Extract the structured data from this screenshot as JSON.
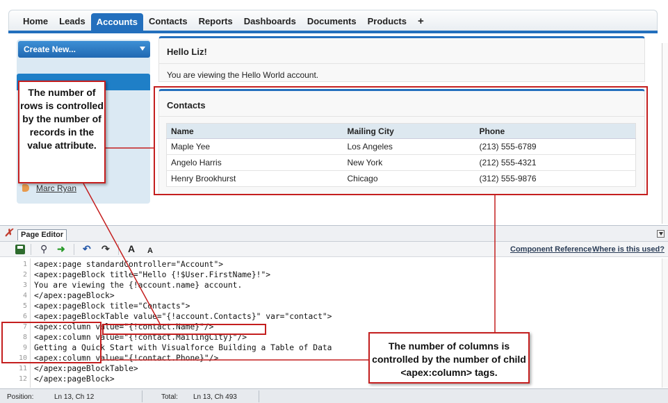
{
  "tabs": [
    "Home",
    "Leads",
    "Accounts",
    "Contacts",
    "Reports",
    "Dashboards",
    "Documents",
    "Products",
    "+"
  ],
  "active_tab": "Accounts",
  "sidebar": {
    "create_new_label": "Create New...",
    "recent_item": "Marc Ryan"
  },
  "hello_panel": {
    "title": "Hello Liz!",
    "body": "You are viewing the Hello World account."
  },
  "contacts_panel": {
    "title": "Contacts",
    "columns": [
      "Name",
      "Mailing City",
      "Phone"
    ],
    "rows": [
      [
        "Maple Yee",
        "Los Angeles",
        "(213) 555-6789"
      ],
      [
        "Angelo Harris",
        "New York",
        "(212) 555-4321"
      ],
      [
        "Henry Brookhurst",
        "Chicago",
        "(312) 555-9876"
      ]
    ]
  },
  "editor": {
    "tab_label": "Page Editor",
    "links": [
      "Component Reference",
      "Where is this used?"
    ],
    "code_lines": [
      "<apex:page standardController=\"Account\">",
      "<apex:pageBlock title=\"Hello {!$User.FirstName}!\">",
      "You are viewing the {!account.name} account.",
      "</apex:pageBlock>",
      "<apex:pageBlock title=\"Contacts\">",
      "<apex:pageBlockTable value=\"{!account.Contacts}\" var=\"contact\">",
      "<apex:column value=\"{!contact.Name}\"/>",
      "<apex:column value=\"{!contact.MailingCity}\"/>",
      "Getting a Quick Start with Visualforce Building a Table of Data",
      "<apex:column value=\"{!contact.Phone}\"/>",
      "</apex:pageBlockTable>",
      "</apex:pageBlock>"
    ],
    "line_numbers": [
      "1",
      "2",
      "3",
      "4",
      "5",
      "6",
      "7",
      "8",
      "9",
      "10",
      "11",
      "12"
    ]
  },
  "status_bar": {
    "position_label": "Position:",
    "position_value": "Ln 13, Ch 12",
    "total_label": "Total:",
    "total_value": "Ln 13, Ch 493"
  },
  "callouts": {
    "rows": "The number of rows is controlled by the number of records in the value attribute.",
    "columns": "The number of columns is controlled by the number of child <apex:column> tags."
  },
  "colors": {
    "accent": "#236fbd",
    "callout_border": "#c41e1e"
  }
}
